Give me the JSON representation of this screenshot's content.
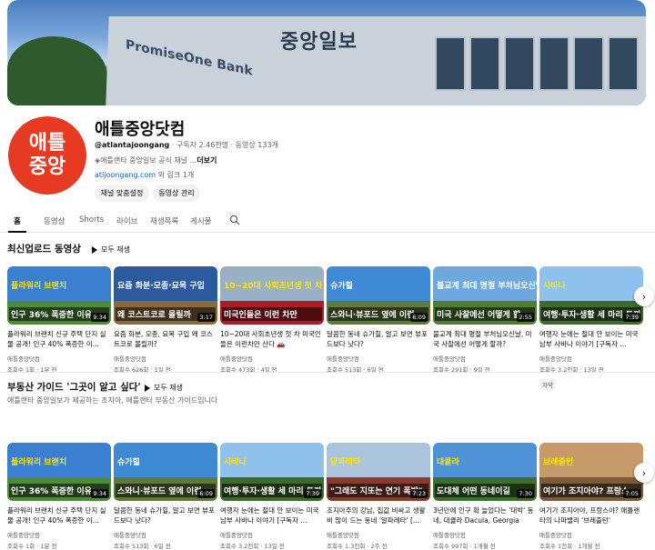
{
  "banner": {
    "sign": "중앙일보",
    "sign2": "PromiseOne Bank"
  },
  "channel": {
    "avatar_line1": "애틀",
    "avatar_line2": "중앙",
    "name": "애틀중앙닷컴",
    "handle": "@atlantajoongang",
    "meta_rest": " · 구독자 2.46천명 · 동영상 133개",
    "desc": "◈애틀랜타 중앙일보 공식 채널 ...",
    "more": "더보기",
    "link": "atljoongang.com",
    "link_rest": " 외 링크 1개",
    "btn_customize": "채널 맞춤설정",
    "btn_manage": "동영상 관리"
  },
  "tabs": [
    "홈",
    "동영상",
    "Shorts",
    "라이브",
    "재생목록",
    "게시물"
  ],
  "icons": {
    "search": "search-icon",
    "play": "play-icon",
    "next": "chevron-right-icon"
  },
  "sections": [
    {
      "title": "최신업로드 동영상",
      "play_all": "모두 재생",
      "subtitle": "",
      "videos": [
        {
          "top": "플라워리 브랜치",
          "cap": "인구 36% 폭증한 이유",
          "dur": "9:34",
          "title": "플라워리 브랜치 신규 주택 단지 실물 공개! 인구 40% 폭증한 이...",
          "channel": "애틀중앙닷컴",
          "stats": "조회수 1회 · 1분 전",
          "sky": "#3b7fd0",
          "ground": "#4d8a3a",
          "capcol": "#ffe400"
        },
        {
          "top": "요즘 화분·모종·묘목 구입",
          "cap": "왜 코스트코로 몰릴까",
          "dur": "3:17",
          "title": "요즘 화분, 모종, 묘목 구입 왜 코스트코로 몰릴까?",
          "channel": "애틀중앙닷컴",
          "stats": "조회수 626회 · 1일 전",
          "sky": "#2c5a9e",
          "ground": "#8a6a3b",
          "capcol": "#ffffff"
        },
        {
          "top": "10~20대 사회초년생 첫 차",
          "cap": "미국인들은 이런 차만",
          "dur": "",
          "title": "10~20대 사회초년생 첫 차 미국인들은 이런차만 산다 🚗",
          "channel": "애틀중앙닷컴",
          "stats": "조회수 473회 · 4일 전",
          "sky": "#9ab0c4",
          "ground": "#b01c24",
          "capcol": "#ffe400"
        },
        {
          "top": "슈가힐",
          "cap": "스와니·뷰포드 옆에 이런",
          "dur": "6:09",
          "title": "달콤한 동네 슈가힐, 알고 보면 뷰포드보다 낫다?",
          "channel": "애틀중앙닷컴",
          "stats": "조회수 513회 · 6일 전",
          "sky": "#3f8ad4",
          "ground": "#5f7a3a",
          "capcol": "#ffffff"
        },
        {
          "top": "불교계 최대 명절 부처님오신날",
          "cap": "미국 사찰에선 어떻게 할",
          "dur": "2:55",
          "title": "불교계 최대 명절 부처님오신날, 미국 사찰에선 어떻게 할까?",
          "channel": "애틀중앙닷컴",
          "stats": "조회수 291회 · 9일 전",
          "sky": "#6fa7df",
          "ground": "#4f7d34",
          "capcol": "#ffffff"
        },
        {
          "top": "사바나",
          "cap": "여행·투자·생활 세 마리 토끼",
          "dur": "7:39",
          "title": "여행자 눈에는 절대 안 보이는 미국 남부 사바나 이야기 [구독자 ...",
          "channel": "애틀중앙닷컴",
          "stats": "조회수 3.2천회 · 13일 전",
          "sky": "#8ec2ec",
          "ground": "#3d6b2c",
          "capcol": "#ffe400",
          "tag": "자막"
        }
      ]
    },
    {
      "title": "부동산 가이드 '그곳이 알고 싶다'",
      "play_all": "모두 재생",
      "subtitle": "애틀랜타 중앙일보가 제공하는 조지아, 애틀랜타 부동산 가이드입니다",
      "videos": [
        {
          "top": "플라워리 브랜치",
          "cap": "인구 36% 폭증한 이유",
          "dur": "9:34",
          "title": "플라워리 브랜치 신규 주택 단지 실물 공개! 인구 40% 폭증한 이...",
          "channel": "애틀중앙닷컴",
          "stats": "조회수 1회 · 1분 전",
          "sky": "#3b7fd0",
          "ground": "#4d8a3a",
          "capcol": "#ffe400"
        },
        {
          "top": "슈가힐",
          "cap": "스와니·뷰포드 옆에 이런",
          "dur": "6:09",
          "title": "달콤한 동네 슈가힐, 알고 보면 뷰포드보다 낫다?",
          "channel": "애틀중앙닷컴",
          "stats": "조회수 513회 · 6일 전",
          "sky": "#3f8ad4",
          "ground": "#5f7a3a",
          "capcol": "#ffffff"
        },
        {
          "top": "사바나",
          "cap": "여행·투자·생활 세 마리 토끼",
          "dur": "7:39",
          "title": "여행자 눈에는 절대 안 보이는 미국 남부 사바나 이야기 [구독자 ...",
          "channel": "애틀중앙닷컴",
          "stats": "조회수 3.2천회 · 13일 전",
          "sky": "#8ec2ec",
          "ground": "#3d6b2c",
          "capcol": "#ffe400"
        },
        {
          "top": "알파레타",
          "cap": "\"그래도 지또는 연기 폭발\"",
          "dur": "7:23",
          "title": "조지아주의 강남, 집값 비싸고 생활비 많이 드는 동네 '알파레타' [...",
          "channel": "애틀중앙닷컴",
          "stats": "조회수 1.3천회 · 2주 전",
          "sky": "#a9c4dc",
          "ground": "#8a3b2c",
          "capcol": "#ffe400"
        },
        {
          "top": "대큘라",
          "cap": "도대체 어떤 동네이길",
          "dur": "7:30",
          "title": "3년만에 인구 확 늘었다는 '대박' 동네, 대큘라 Dacula, Georgia",
          "channel": "애틀중앙닷컴",
          "stats": "조회수 997회 · 1개월 전",
          "sky": "#4f93d6",
          "ground": "#3e6f2f",
          "capcol": "#ffe400"
        },
        {
          "top": "브레즐턴",
          "cap": "여기가 조지아야? 프랑스",
          "dur": "7:05",
          "title": "여기가 조지아야, 프랑스야? 애틀랜타의 나파밸리 '브레즐턴'",
          "channel": "애틀중앙닷컴",
          "stats": "조회수 1천회 · 1개월 전",
          "sky": "#c79a6a",
          "ground": "#7a5c3a",
          "capcol": "#ffe400"
        }
      ]
    }
  ]
}
